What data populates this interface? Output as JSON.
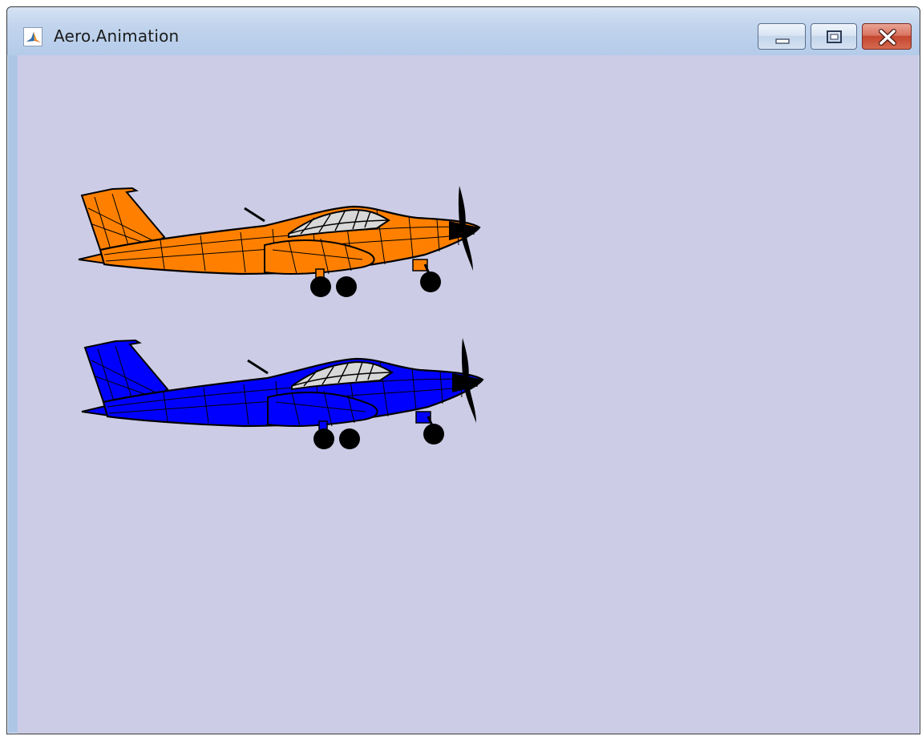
{
  "window": {
    "title": "Aero.Animation",
    "app_icon": "matlab-membrane-icon",
    "controls": {
      "minimize_icon": "minimize-icon",
      "maximize_icon": "maximize-icon",
      "close_icon": "close-icon"
    }
  },
  "scene": {
    "background_color": "#cccce6",
    "aircraft": [
      {
        "name": "aircraft-1",
        "color": "#ff8000"
      },
      {
        "name": "aircraft-2",
        "color": "#0000ff"
      }
    ]
  }
}
